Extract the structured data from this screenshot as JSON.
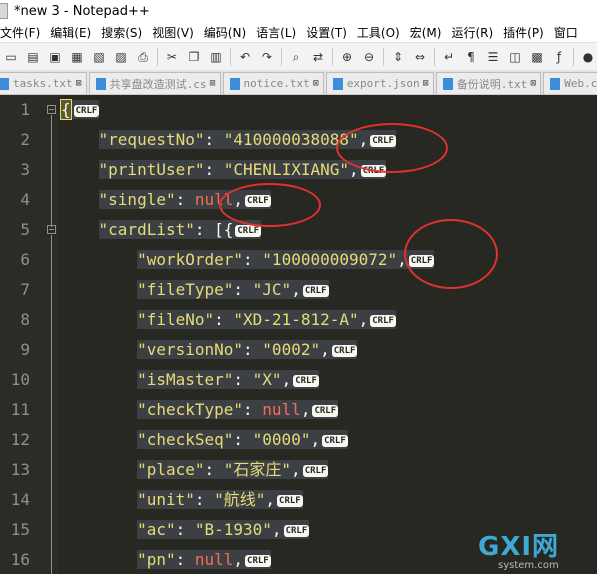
{
  "window": {
    "title": "*new 3 - Notepad++"
  },
  "menu": [
    "文件(F)",
    "编辑(E)",
    "搜索(S)",
    "视图(V)",
    "编码(N)",
    "语言(L)",
    "设置(T)",
    "工具(O)",
    "宏(M)",
    "运行(R)",
    "插件(P)",
    "窗口"
  ],
  "tabs": [
    {
      "label": "tasks.txt"
    },
    {
      "label": "共享盘改造测试.cs"
    },
    {
      "label": "notice.txt"
    },
    {
      "label": "export.json"
    },
    {
      "label": "备份说明.txt"
    },
    {
      "label": "Web.c"
    }
  ],
  "editor": {
    "lines": [
      {
        "n": "1",
        "key": "",
        "val": "",
        "open": "{"
      },
      {
        "n": "2",
        "key": "\"requestNo\"",
        "val": "\"410000038088\""
      },
      {
        "n": "3",
        "key": "\"printUser\"",
        "val": "\"CHENLIXIANG\""
      },
      {
        "n": "4",
        "key": "\"single\"",
        "val": "null"
      },
      {
        "n": "5",
        "key": "\"cardList\"",
        "val": "[{"
      },
      {
        "n": "6",
        "key": "\"workOrder\"",
        "val": "\"100000009072\""
      },
      {
        "n": "7",
        "key": "\"fileType\"",
        "val": "\"JC\""
      },
      {
        "n": "8",
        "key": "\"fileNo\"",
        "val": "\"XD-21-812-A\""
      },
      {
        "n": "9",
        "key": "\"versionNo\"",
        "val": "\"0002\""
      },
      {
        "n": "10",
        "key": "\"isMaster\"",
        "val": "\"X\""
      },
      {
        "n": "11",
        "key": "\"checkType\"",
        "val": "null"
      },
      {
        "n": "12",
        "key": "\"checkSeq\"",
        "val": "\"0000\""
      },
      {
        "n": "13",
        "key": "\"place\"",
        "val": "\"石家庄\""
      },
      {
        "n": "14",
        "key": "\"unit\"",
        "val": "\"航线\""
      },
      {
        "n": "15",
        "key": "\"ac\"",
        "val": "\"B-1930\""
      },
      {
        "n": "16",
        "key": "\"pn\"",
        "val": "null"
      }
    ],
    "eol_marker": "CRLF",
    "colors": {
      "bg": "#272822",
      "string": "#e6db74",
      "null": "#f76d54",
      "linenum": "#8f908a",
      "annotation": "#e03131"
    }
  },
  "watermark": {
    "text": "GXI网",
    "sub": "system.com"
  }
}
